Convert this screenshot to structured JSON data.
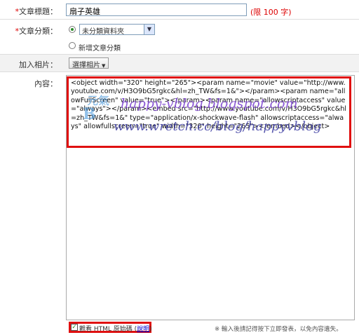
{
  "title_row": {
    "label_star": "*",
    "label": "文章標題：",
    "value": "扇子英雄",
    "hint": "(限 100 字)"
  },
  "category_row": {
    "label_star": "*",
    "label": "文章分類：",
    "selected": "未分類資料夾",
    "new_option": "新增文章分類"
  },
  "photo_row": {
    "label": "加入相片：",
    "button": "選擇相片"
  },
  "content_row": {
    "label": "內容：",
    "code_text": "<object width=\"320\" height=\"265\"><param name=\"movie\" value=\"http://www.youtube.com/v/H3O9bG5rgkc&hl=zh_TW&fs=1&\"></param><param name=\"allowFullScreen\" value=\"true\"></param><param name=\"allowscriptaccess\" value=\"always\"></param><embed src=\"http://www.youtube.com/v/H3O9bG5rgkc&hl=zh_TW&fs=1&\" type=\"application/x-shockwave-flash\" allowscriptaccess=\"always\" allowfullscreen=\"true\" width=\"320\" height=\"265\"></embed></object>"
  },
  "watermarks": {
    "line1": "happy-vblog.blogspot.com",
    "line2": "www.wretch.cc/blog/happyvblog",
    "logo_top": "元氣",
    "logo_bottom": "B"
  },
  "footer": {
    "checkbox_label": "觀看 HTML 原始碼",
    "help_link": "說明",
    "checkbox_checked": true,
    "note": "※ 輸入後請記得按下立即發表，以免內容遺失。"
  },
  "colors": {
    "highlight": "#e01010",
    "watermark_purple": "#7a3fd0",
    "watermark_blue": "#3a8fd8"
  }
}
